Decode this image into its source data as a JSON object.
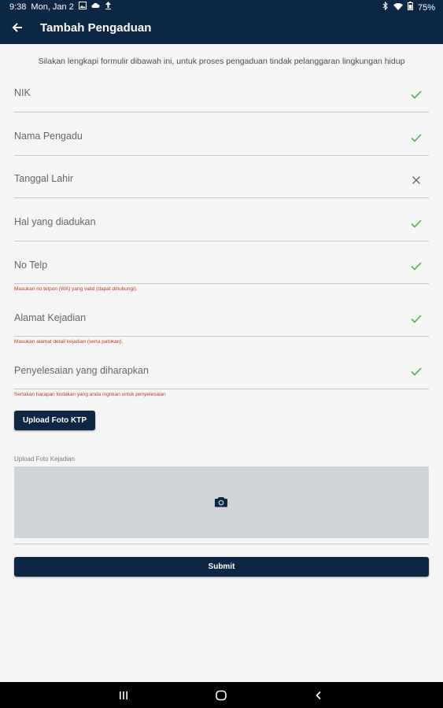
{
  "status_bar": {
    "time": "9:38",
    "date": "Mon, Jan 2",
    "battery": "75%",
    "left_icons": [
      "gallery-icon",
      "cloud-icon",
      "upload-icon"
    ],
    "right_icons": [
      "bluetooth-icon",
      "wifi-icon",
      "battery-icon"
    ]
  },
  "app_bar": {
    "title": "Tambah Pengaduan",
    "back_icon": "arrow-left-icon"
  },
  "form": {
    "intro": "Silakan lengkapi formulir dibawah ini, untuk proses pengaduan tindak pelanggaran lingkungan hidup",
    "fields": [
      {
        "label": "NIK",
        "status": "valid"
      },
      {
        "label": "Nama Pengadu",
        "status": "valid"
      },
      {
        "label": "Tanggal Lahir",
        "status": "invalid"
      },
      {
        "label": "Hal yang diadukan",
        "status": "valid"
      },
      {
        "label": "No Telp",
        "status": "valid",
        "helper": "Masukan no telpon (WA) yang valid (dapat dihubungi)."
      },
      {
        "label": "Alamat Kejadian",
        "status": "valid",
        "helper": "Masukan alamat detail kejadian (serta patokan)."
      },
      {
        "label": "Penyelesaian yang diharapkan",
        "status": "valid",
        "helper": "Sertakan harapan tindakan yang anda ingnkan untuk penyelesaian"
      }
    ],
    "upload_ktp_label": "Upload Foto KTP",
    "upload_kejadian_label": "Upload Foto Kejadian",
    "camera_icon": "camera-icon",
    "submit_label": "Submit"
  },
  "colors": {
    "primary": "#0b2744",
    "valid": "#4caf50",
    "invalid": "#6b6b6b",
    "helper": "#c0392b",
    "background": "#f5f5f5",
    "photo_box": "#cfd4d9"
  },
  "nav_bar": {
    "buttons": [
      "recent-apps-icon",
      "home-icon",
      "back-icon"
    ]
  }
}
